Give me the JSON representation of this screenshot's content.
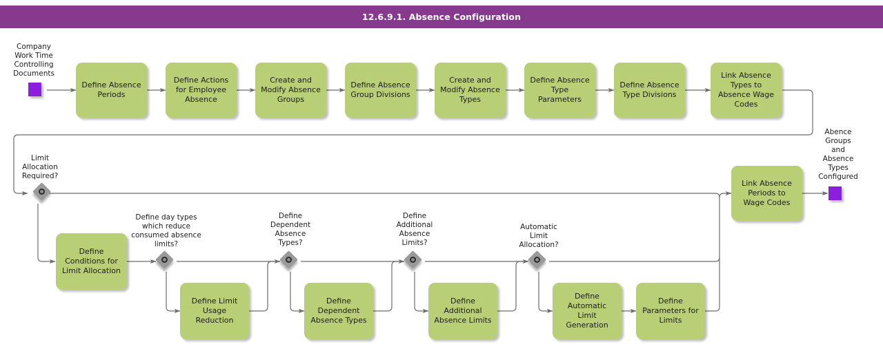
{
  "header": {
    "title": "12.6.9.1. Absence Configuration",
    "bar_color": "#87398D",
    "title_color": "#FFFFFF"
  },
  "theme": {
    "node_fill": "#B9CF76",
    "marker_fill": "#8A1FE0",
    "gateway_fill": "#9A9A9A",
    "connector_color": "#6B6B6B",
    "canvas_background": "#FFFFFF"
  },
  "diagram": {
    "type": "flowchart",
    "start_event": {
      "name": "start-marker",
      "label": "Company\nWork Time\nControlling\nDocuments"
    },
    "end_event": {
      "name": "end-marker",
      "label": "Abence\nGroups\nand\nAbsence\nTypes\nConfigured"
    },
    "top_row_nodes": [
      {
        "id": "define-absence-periods",
        "label": "Define Absence\nPeriods"
      },
      {
        "id": "define-actions-for-employee-absence",
        "label": "Define Actions\nfor Employee\nAbsence"
      },
      {
        "id": "create-and-modify-absence-groups",
        "label": "Create and\nModify Absence\nGroups"
      },
      {
        "id": "define-absence-group-divisions",
        "label": "Define Absence\nGroup Divisions"
      },
      {
        "id": "create-and-modify-absence-types",
        "label": "Create and\nModify Absence\nTypes"
      },
      {
        "id": "define-absence-type-parameters",
        "label": "Define Absence\nType\nParameters"
      },
      {
        "id": "define-absence-type-divisions",
        "label": "Define Absence\nType Divisions"
      },
      {
        "id": "link-absence-types-to-absence-wage-codes",
        "label": "Link Absence\nTypes to\nAbsence Wage\nCodes"
      }
    ],
    "gateways": [
      {
        "id": "limit-allocation-required",
        "label": "Limit\nAllocation\nRequired?"
      },
      {
        "id": "define-day-types-reduce",
        "label": "Define day types\nwhich reduce\nconsumed absence\nlimits?"
      },
      {
        "id": "define-dependent-absence-types",
        "label": "Define\nDependent\nAbsence\nTypes?"
      },
      {
        "id": "define-additional-absence-limits",
        "label": "Define\nAdditional\nAbsence\nLimits?"
      },
      {
        "id": "automatic-limit-allocation",
        "label": "Automatic\nLimit\nAllocation?"
      }
    ],
    "lower_nodes": [
      {
        "id": "define-conditions-for-limit-allocation",
        "label": "Define\nConditions for\nLimit Allocation"
      },
      {
        "id": "define-limit-usage-reduction",
        "label": "Define Limit\nUsage Reduction"
      },
      {
        "id": "define-dependent-absence-types-task",
        "label": "Define\nDependent\nAbsence Types"
      },
      {
        "id": "define-additional-absence-limits-task",
        "label": "Define\nAdditional\nAbsence Limits"
      },
      {
        "id": "define-automatic-limit-generation",
        "label": "Define Automatic\nLimit Generation"
      },
      {
        "id": "define-parameters-for-limits",
        "label": "Define\nParameters for\nLimits"
      },
      {
        "id": "link-absence-periods-to-wage-codes",
        "label": "Link Absence\nPeriods to\nWage Codes"
      }
    ]
  }
}
